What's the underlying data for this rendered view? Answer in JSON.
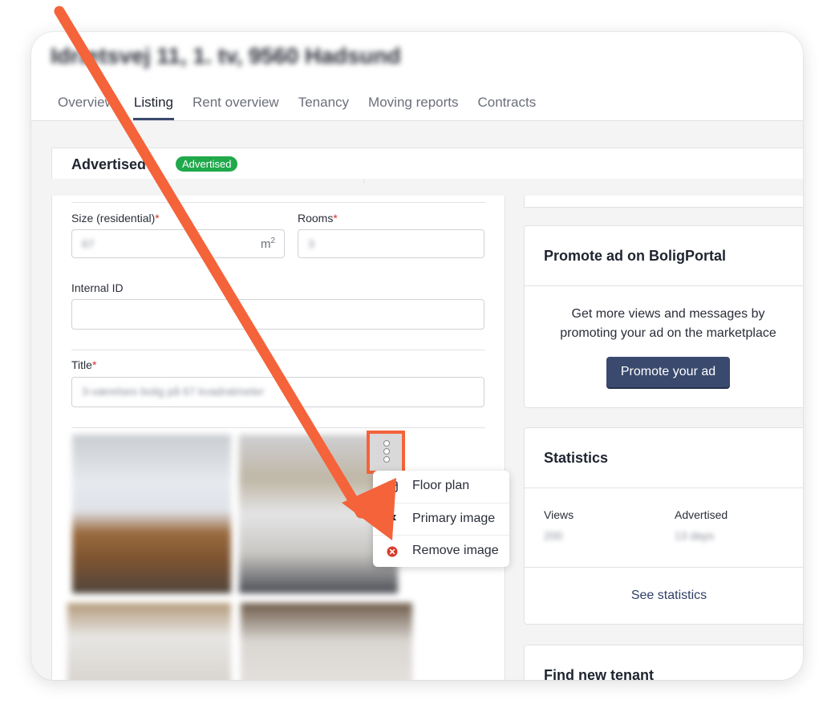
{
  "header": {
    "address": "Idrætsvej 11, 1. tv, 9560 Hadsund",
    "tabs": [
      "Overview",
      "Listing",
      "Rent overview",
      "Tenancy",
      "Moving reports",
      "Contracts"
    ],
    "active_tab": "Listing"
  },
  "advertised": {
    "title": "Advertised",
    "badge": "Advertised"
  },
  "form": {
    "size_label": "Size (residential)",
    "size_value": "67",
    "size_unit": "m",
    "size_unit_sup": "2",
    "rooms_label": "Rooms",
    "rooms_value": "3",
    "internal_id_label": "Internal ID",
    "internal_id_value": "",
    "title_label": "Title",
    "title_value": "3-værelses bolig på 67 kvadratmeter",
    "required_mark": "*"
  },
  "image_menu": {
    "items": [
      {
        "label": "Floor plan",
        "icon": "floor-plan-icon"
      },
      {
        "label": "Primary image",
        "icon": "flag-icon"
      },
      {
        "label": "Remove image",
        "icon": "remove-circle-icon"
      }
    ]
  },
  "promote": {
    "title": "Promote ad on BoligPortal",
    "text": "Get more views and messages by promoting your ad on the marketplace",
    "button": "Promote your ad"
  },
  "statistics": {
    "title": "Statistics",
    "views_label": "Views",
    "views_value": "200",
    "advertised_label": "Advertised",
    "advertised_value": "13 days",
    "link": "See statistics"
  },
  "find_tenant": {
    "title": "Find new tenant"
  },
  "colors": {
    "accent": "#3a4a6e",
    "badge_green": "#1fa94b",
    "annotation_orange": "#f4633a",
    "remove_red": "#d83a2a"
  }
}
